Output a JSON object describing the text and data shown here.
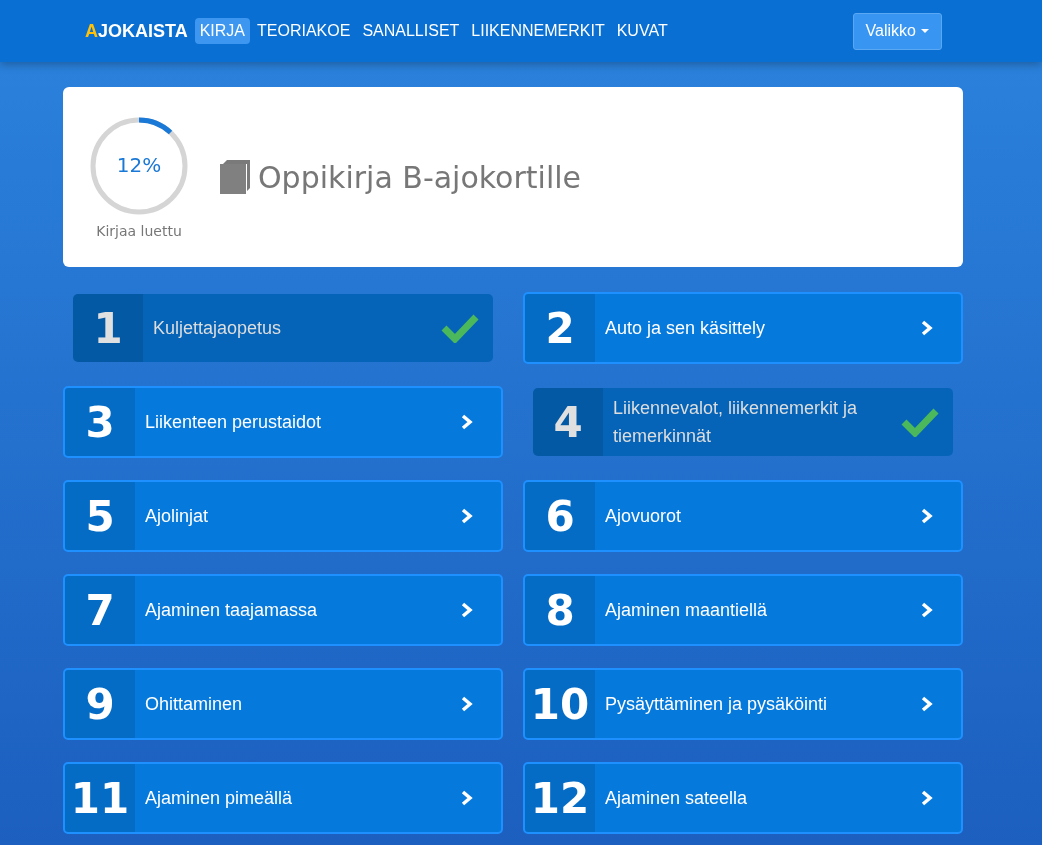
{
  "nav": {
    "logo": "AJOKAISTA",
    "items": [
      {
        "label": "KIRJA",
        "selected": true
      },
      {
        "label": "TEORIAKOE",
        "selected": false
      },
      {
        "label": "SANALLISET",
        "selected": false
      },
      {
        "label": "LIIKENNEMERKIT",
        "selected": false
      },
      {
        "label": "KUVAT",
        "selected": false
      }
    ],
    "menu_button": "Valikko"
  },
  "header": {
    "progress": {
      "level": 0.12,
      "reading": "12%",
      "caption": "Kirjaa luettu"
    },
    "title": "Oppikirja B-ajokortille"
  },
  "chapters": [
    {
      "number": "1",
      "title": "Kuljettajaopetus",
      "completed": true
    },
    {
      "number": "2",
      "title": "Auto ja sen käsittely",
      "completed": false
    },
    {
      "number": "3",
      "title": "Liikenteen perustaidot",
      "completed": false
    },
    {
      "number": "4",
      "title": "Liikennevalot, liikennemerkit ja tiemerkinnät",
      "completed": true
    },
    {
      "number": "5",
      "title": "Ajolinjat",
      "completed": false
    },
    {
      "number": "6",
      "title": "Ajovuorot",
      "completed": false
    },
    {
      "number": "7",
      "title": "Ajaminen taajamassa",
      "completed": false
    },
    {
      "number": "8",
      "title": "Ajaminen maantiellä",
      "completed": false
    },
    {
      "number": "9",
      "title": "Ohittaminen",
      "completed": false
    },
    {
      "number": "10",
      "title": "Pysäyttäminen ja pysäköinti",
      "completed": false
    },
    {
      "number": "11",
      "title": "Ajaminen pimeällä",
      "completed": false
    },
    {
      "number": "12",
      "title": "Ajaminen sateella",
      "completed": false
    }
  ]
}
